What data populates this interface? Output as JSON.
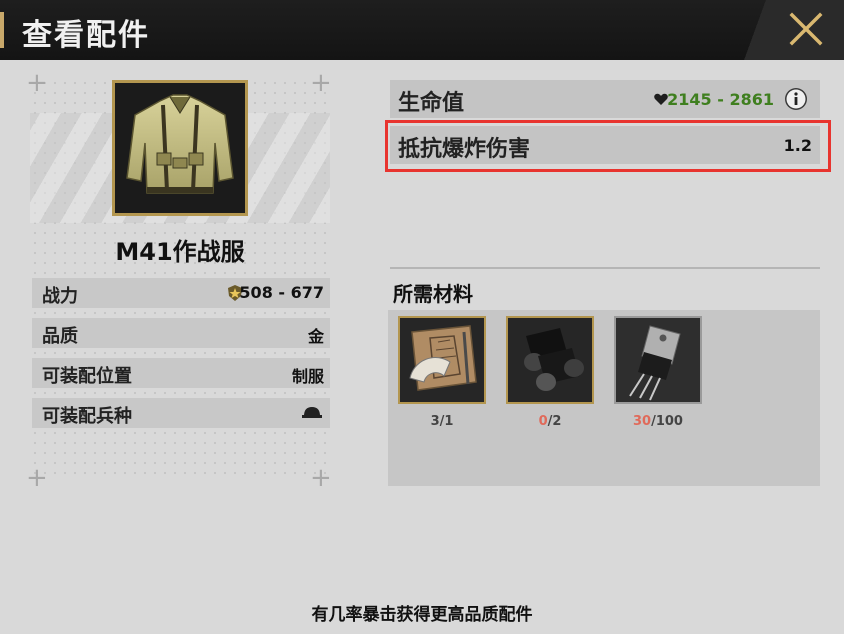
{
  "window": {
    "title": "查看配件"
  },
  "item": {
    "name": "M41作战服",
    "properties": [
      {
        "label": "战力",
        "value": "508 - 677",
        "icon": "star-shield-icon"
      },
      {
        "label": "品质",
        "value": "金"
      },
      {
        "label": "可装配位置",
        "value": "制服"
      },
      {
        "label": "可装配兵种",
        "value": "",
        "icon": "helmet-icon"
      }
    ]
  },
  "stats": [
    {
      "label": "生命值",
      "value": "2145 - 2861",
      "icon": "heart-icon",
      "color": "#3f7f1f"
    },
    {
      "label": "抵抗爆炸伤害",
      "value": "1.2",
      "color": "#111111"
    }
  ],
  "materials": {
    "title": "所需材料",
    "items": [
      {
        "name": "blueprint-icon",
        "have": "3",
        "need": "/1",
        "sufficient": true
      },
      {
        "name": "cloth-rolls-icon",
        "have": "0",
        "need": "/2",
        "sufficient": false
      },
      {
        "name": "transistor-icon",
        "have": "30",
        "need": "/100",
        "sufficient": false
      }
    ]
  },
  "footer": {
    "tip": "有几率暴击获得更高品质配件"
  },
  "colors": {
    "highlight": "#e8342f",
    "gold_border": "#b3964f",
    "green_value": "#3f7f1f",
    "short_count": "#e06a5a"
  }
}
